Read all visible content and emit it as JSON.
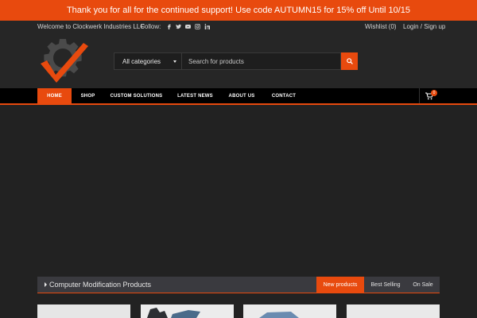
{
  "promo": {
    "text": "Thank you for all for the continued support! Use code AUTUMN15 for 15% off Until 10/15"
  },
  "topbar": {
    "welcome": "Welcome to Clockwerk Industries LLC",
    "follow_label": "Follow:",
    "social_icons": [
      "facebook-icon",
      "twitter-icon",
      "youtube-icon",
      "instagram-icon",
      "linkedin-icon"
    ],
    "wishlist": "Wishlist (0)",
    "login": "Login / Sign up"
  },
  "search": {
    "category": "All categories",
    "placeholder": "Search for products"
  },
  "nav": {
    "items": [
      "HOME",
      "SHOP",
      "CUSTOM SOLUTIONS",
      "LATEST NEWS",
      "ABOUT US",
      "CONTACT"
    ],
    "active": "HOME",
    "cart_count": "0"
  },
  "products": {
    "title": "Computer Modification Products",
    "tabs": [
      "New products",
      "Best Selling",
      "On Sale"
    ],
    "active_tab": "New products"
  },
  "colors": {
    "accent": "#e84a0e",
    "background": "#222222",
    "nav": "#000000",
    "bar": "#3a3a3f"
  }
}
